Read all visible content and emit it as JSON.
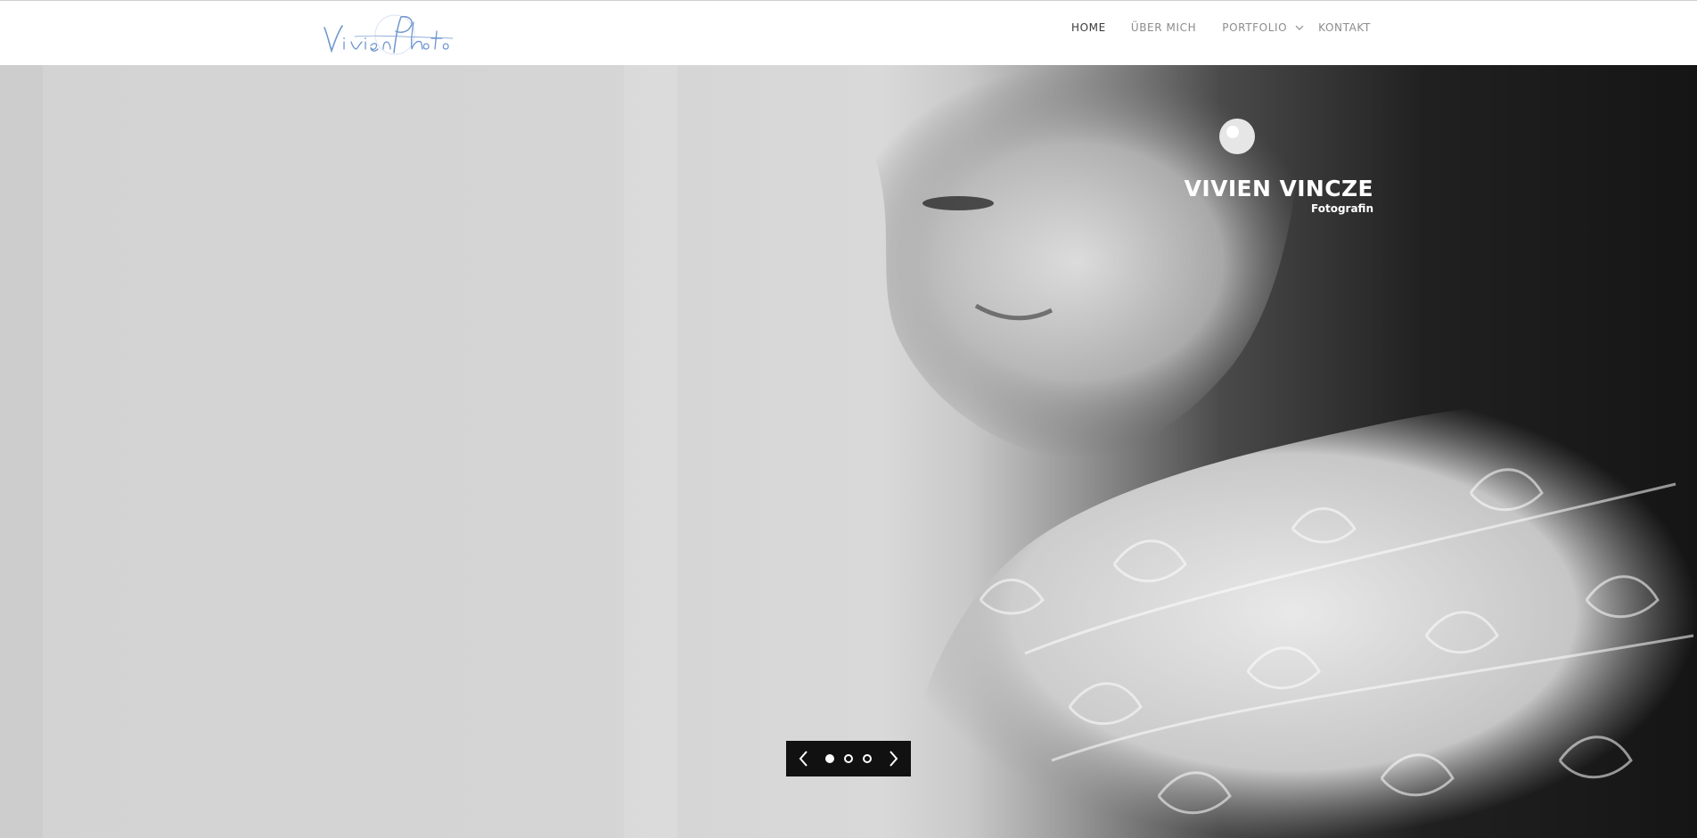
{
  "site": {
    "logo_alt": "Vivien Photo"
  },
  "nav": {
    "home": "HOME",
    "about": "ÜBER MICH",
    "portfolio": "PORTFOLIO",
    "contact": "KONTAKT"
  },
  "hero": {
    "name": "VIVIEN VINCZE",
    "role": "Fotografin"
  },
  "slider": {
    "slide_count": 3,
    "active_slide": 1
  },
  "colors": {
    "logo": "#6f96cf",
    "nav_text": "#8c8c8c",
    "nav_active": "#3a3a3a",
    "control_bg": "#111111"
  }
}
